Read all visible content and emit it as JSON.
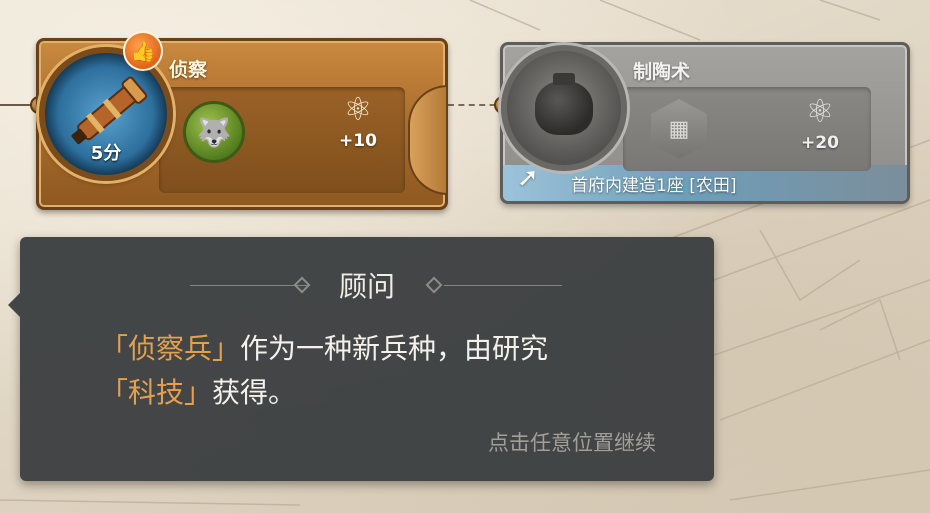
{
  "tech_cards": [
    {
      "name": "侦察",
      "time": "5分",
      "reward_value": "+10",
      "reward_icon": "atom-icon",
      "unit_icon": "wolf-icon",
      "state": "active"
    },
    {
      "name": "制陶术",
      "reward_value": "+20",
      "reward_icon": "atom-icon",
      "building_icon": "farm-building-icon",
      "requirement": "首府内建造1座 [农田]",
      "state": "locked"
    }
  ],
  "dialog": {
    "title": "顾问",
    "line1_hl": "「侦察兵」",
    "line1_rest": "作为一种新兵种，由研究",
    "line2_hl": "「科技」",
    "line2_rest": "获得。",
    "hint": "点击任意位置继续"
  },
  "colors": {
    "highlight": "#e5a04e",
    "dialog_bg": "#3a3d3f",
    "active_card": "#b47a36",
    "locked_card": "#8d8b88"
  }
}
